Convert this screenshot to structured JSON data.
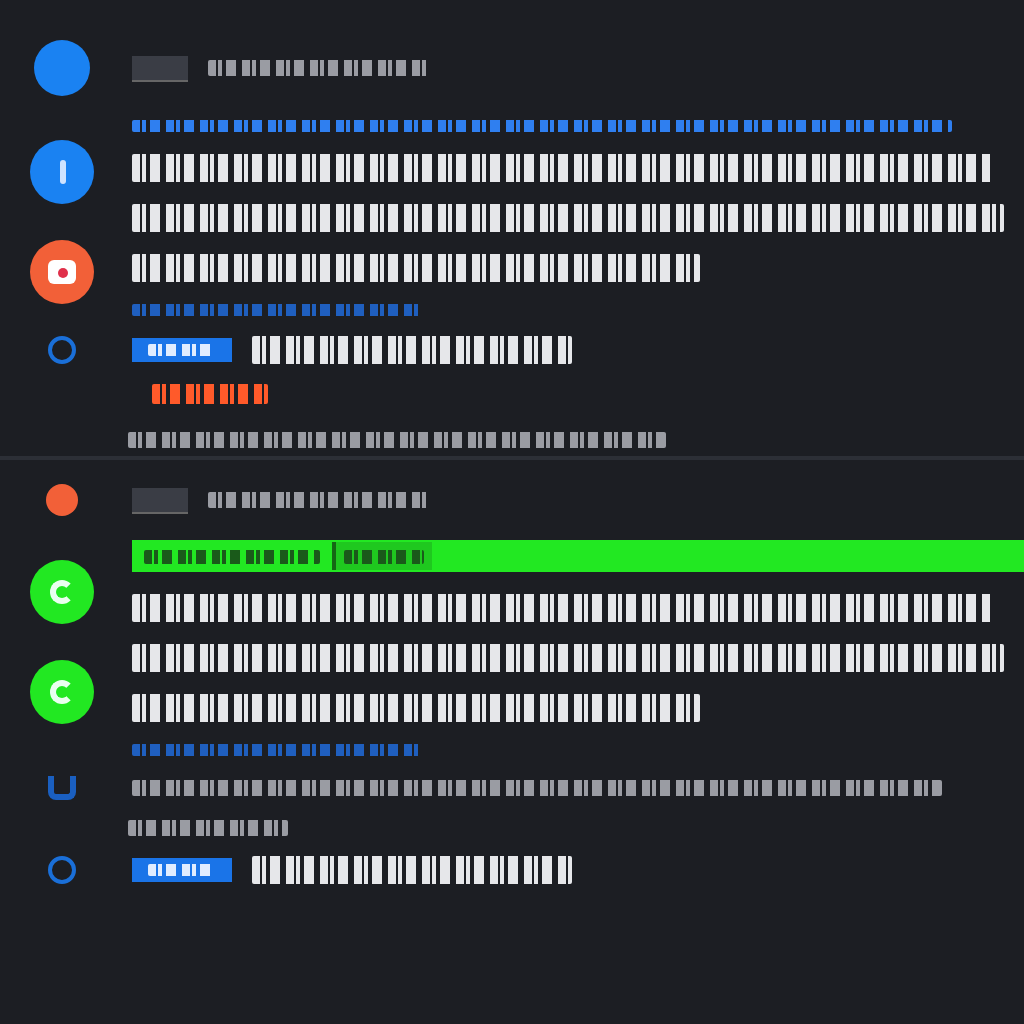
{
  "threads": [
    {
      "items": [
        {
          "kind": "header",
          "avatar": {
            "kind": "large",
            "color": "#1a82f2"
          }
        },
        {
          "kind": "post",
          "avatars": [
            {
              "kind": "bar",
              "color": "#1a82f2"
            },
            {
              "kind": "square",
              "color": "#f26038"
            }
          ],
          "lines": [
            {
              "kind": "link"
            },
            {
              "kind": "body"
            },
            {
              "kind": "body"
            },
            {
              "kind": "body-end"
            },
            {
              "kind": "caption"
            }
          ]
        },
        {
          "kind": "tagged-reply"
        },
        {
          "kind": "note",
          "lines": [
            {
              "kind": "alert"
            },
            {
              "kind": "meta"
            }
          ]
        }
      ]
    },
    {
      "items": [
        {
          "kind": "header",
          "avatar": {
            "kind": "small",
            "color": "#f26038"
          }
        },
        {
          "kind": "post",
          "avatars": [
            {
              "kind": "c",
              "color": "#22e822"
            },
            {
              "kind": "c",
              "color": "#22e822"
            }
          ],
          "lines": [
            {
              "kind": "banner"
            },
            {
              "kind": "body"
            },
            {
              "kind": "body"
            },
            {
              "kind": "body-end"
            },
            {
              "kind": "caption"
            }
          ]
        },
        {
          "kind": "comment"
        },
        {
          "kind": "note",
          "lines": [
            {
              "kind": "meta-short"
            }
          ]
        },
        {
          "kind": "tagged-reply"
        }
      ]
    }
  ]
}
